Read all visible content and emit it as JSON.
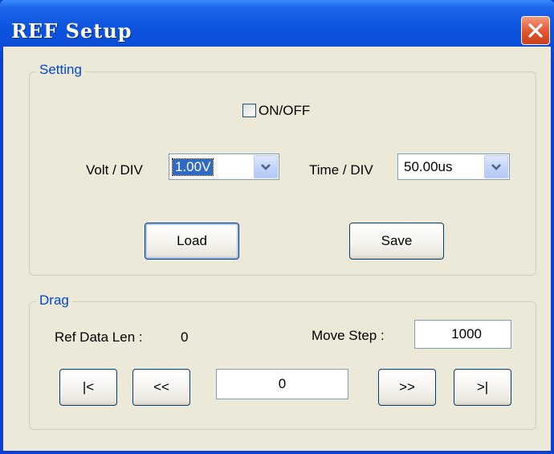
{
  "window": {
    "title": "REF Setup",
    "close_icon": "close-x-icon",
    "colors": {
      "titlebar": "#0a4bd6",
      "close": "#e2552d",
      "client": "#ece9d8",
      "legend": "#0046d5"
    }
  },
  "setting_group": {
    "legend": "Setting",
    "on_off": {
      "label": "ON/OFF",
      "checked": false
    },
    "volt_div": {
      "label": "Volt / DIV",
      "selected": "1.00V"
    },
    "time_div": {
      "label": "Time / DIV",
      "selected": "50.00us"
    },
    "load_label": "Load",
    "save_label": "Save"
  },
  "drag_group": {
    "legend": "Drag",
    "ref_data_len_label": "Ref Data Len :",
    "ref_data_len_value": "0",
    "move_step_label": "Move Step :",
    "move_step_value": "1000",
    "position_value": "0",
    "first_label": "|<",
    "prev_label": "<<",
    "next_label": ">>",
    "last_label": ">|"
  }
}
